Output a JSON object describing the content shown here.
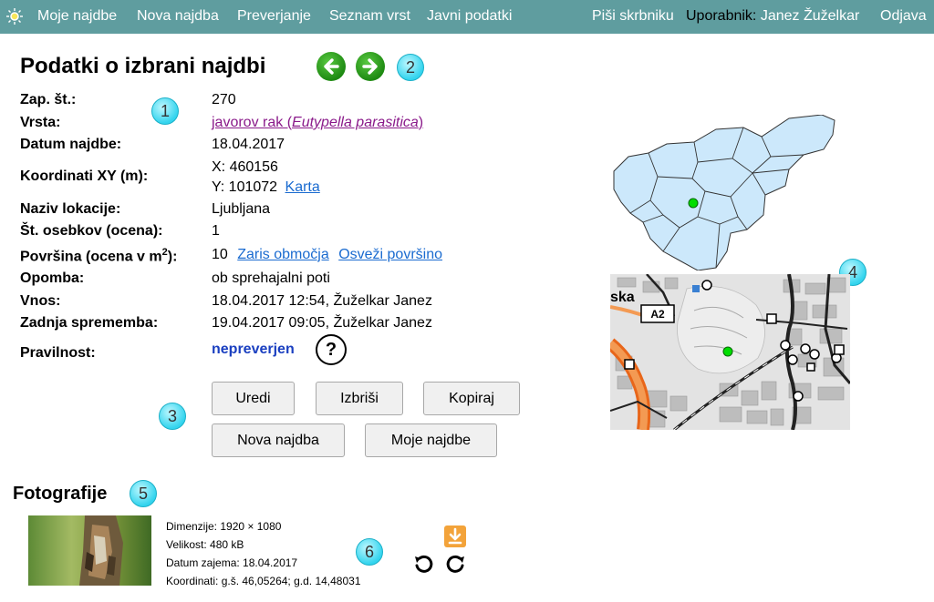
{
  "nav": {
    "items": [
      "Moje najdbe",
      "Nova najdba",
      "Preverjanje",
      "Seznam vrst",
      "Javni podatki"
    ],
    "contact": "Piši skrbniku",
    "user_label": "Uporabnik:",
    "user_name": "Janez Žuželkar",
    "logout": "Odjava"
  },
  "page_title": "Podatki o izbrani najdbi",
  "badges": [
    "1",
    "2",
    "3",
    "4",
    "5",
    "6"
  ],
  "record": {
    "zap_label": "Zap. št.:",
    "zap_value": "270",
    "vrsta_label": "Vrsta:",
    "vrsta_common": "javorov rak (",
    "vrsta_latin": "Eutypella parasitica",
    "vrsta_close": ")",
    "datum_label": "Datum najdbe:",
    "datum_value": "18.04.2017",
    "koord_label": "Koordinati XY (m):",
    "koord_x": "X: 460156",
    "koord_y": "Y: 101072",
    "koord_link": "Karta",
    "lokacija_label": "Naziv lokacije:",
    "lokacija_value": "Ljubljana",
    "osebki_label": "Št. osebkov (ocena):",
    "osebki_value": "1",
    "povrsina_label_pre": "Površina (ocena v m",
    "povrsina_label_sup": "2",
    "povrsina_label_post": "):",
    "povrsina_value": "10",
    "povrsina_link1": "Zaris območja",
    "povrsina_link2": "Osveži površino",
    "opomba_label": "Opomba:",
    "opomba_value": "ob sprehajalni poti",
    "vnos_label": "Vnos:",
    "vnos_value": "18.04.2017 12:54, Žuželkar Janez",
    "zadnja_label": "Zadnja sprememba:",
    "zadnja_value": "19.04.2017 09:05, Žuželkar Janez",
    "pravilnost_label": "Pravilnost:",
    "pravilnost_value": "nepreverjen",
    "help_glyph": "?"
  },
  "buttons": {
    "uredi": "Uredi",
    "izbrisi": "Izbriši",
    "kopiraj": "Kopiraj",
    "nova": "Nova najdba",
    "moje": "Moje najdbe"
  },
  "photos_title": "Fotografije",
  "photo_meta": {
    "dimenzije": "Dimenzije: 1920 × 1080",
    "velikost": "Velikost: 480 kB",
    "datum": "Datum zajema: 18.04.2017",
    "koordinati": "Koordinati: g.š. 46,05264; g.d. 14,48031"
  },
  "map_labels": {
    "road": "A2",
    "place": "ska"
  },
  "colors": {
    "topbar": "#5f9d9f",
    "badge": "#33d4ee",
    "region_fill": "#cce8fb",
    "marker": "#00dd00"
  }
}
